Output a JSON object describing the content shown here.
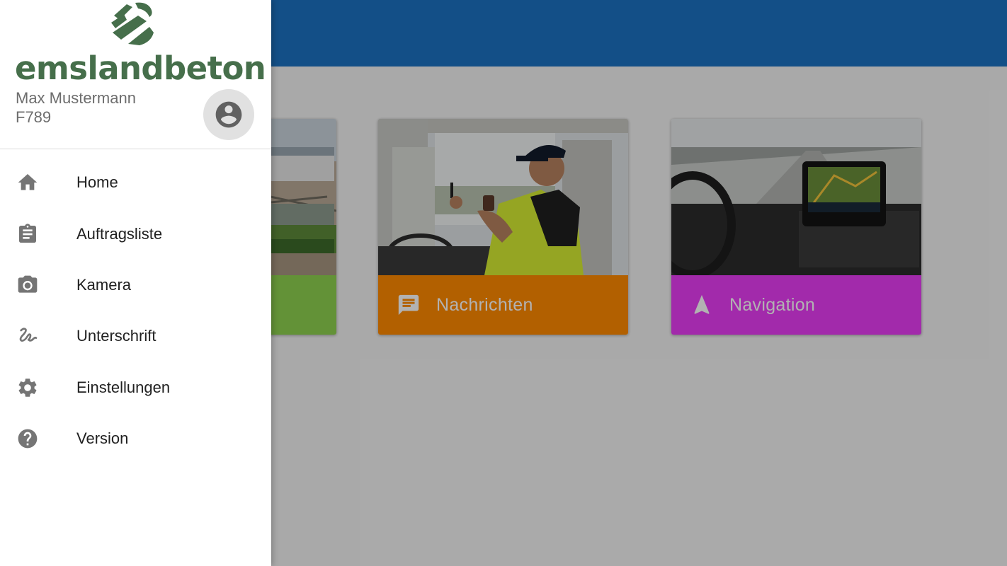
{
  "drawer": {
    "logo_text": "emslandbeton",
    "user_name": "Max Mustermann",
    "user_id": "F789",
    "menu": [
      {
        "label": "Home",
        "icon": "home-icon"
      },
      {
        "label": "Auftragsliste",
        "icon": "clipboard-icon"
      },
      {
        "label": "Kamera",
        "icon": "camera-icon"
      },
      {
        "label": "Unterschrift",
        "icon": "signature-icon"
      },
      {
        "label": "Einstellungen",
        "icon": "gear-icon"
      },
      {
        "label": "Version",
        "icon": "help-icon"
      }
    ]
  },
  "cards": [
    {
      "label": "",
      "icon": "",
      "color": "#8ed14f"
    },
    {
      "label": "Nachrichten",
      "icon": "message-icon",
      "color": "#ff8a00"
    },
    {
      "label": "Navigation",
      "icon": "navigation-arrow-icon",
      "color": "#e93df5"
    }
  ],
  "colors": {
    "appbar": "#1c72c2",
    "logo_green": "#466f4b",
    "icon_gray": "#757575"
  }
}
